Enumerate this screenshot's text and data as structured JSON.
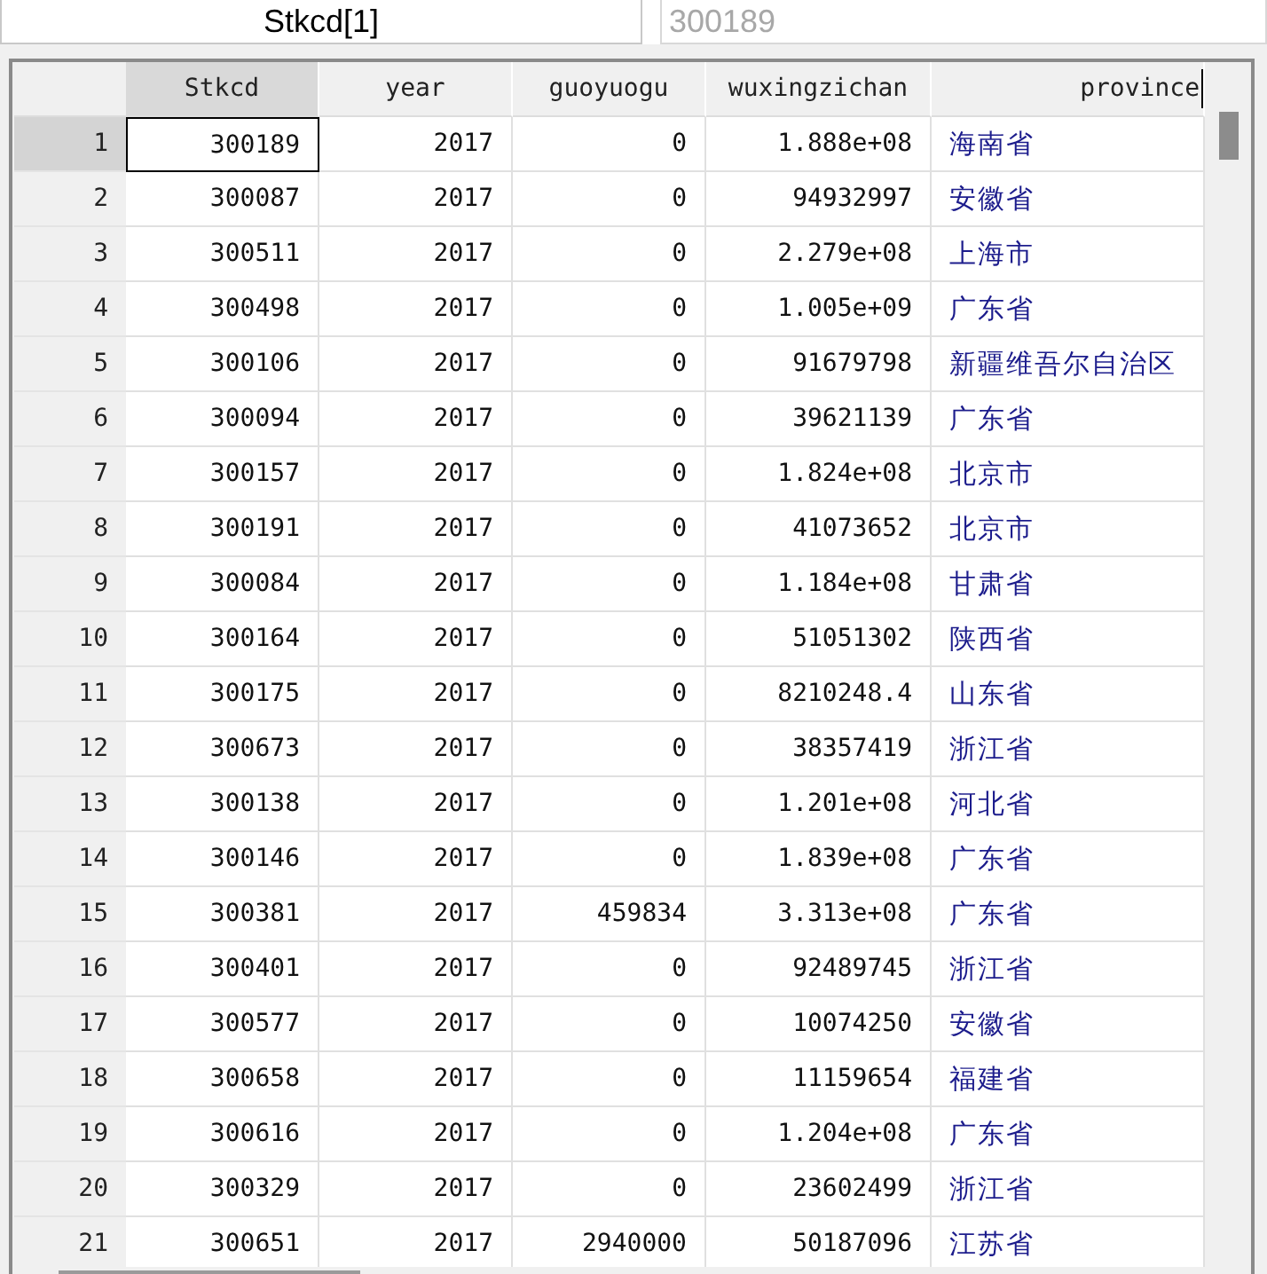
{
  "variable_box": {
    "label": "Stkcd[1]"
  },
  "value_field": {
    "value": "300189",
    "disabled": true
  },
  "table": {
    "columns": [
      {
        "name": "Stkcd",
        "kind": "numeric",
        "selected": true
      },
      {
        "name": "year",
        "kind": "numeric",
        "selected": false
      },
      {
        "name": "guoyuogu",
        "kind": "numeric",
        "selected": false
      },
      {
        "name": "wuxingzichan",
        "kind": "numeric",
        "selected": false
      },
      {
        "name": "province",
        "kind": "string",
        "selected": false
      }
    ],
    "rows": [
      {
        "number": "1",
        "selected": true,
        "cells": [
          "300189",
          "2017",
          "0",
          "1.888e+08",
          "海南省"
        ]
      },
      {
        "number": "2",
        "selected": false,
        "cells": [
          "300087",
          "2017",
          "0",
          "94932997",
          "安徽省"
        ]
      },
      {
        "number": "3",
        "selected": false,
        "cells": [
          "300511",
          "2017",
          "0",
          "2.279e+08",
          "上海市"
        ]
      },
      {
        "number": "4",
        "selected": false,
        "cells": [
          "300498",
          "2017",
          "0",
          "1.005e+09",
          "广东省"
        ]
      },
      {
        "number": "5",
        "selected": false,
        "cells": [
          "300106",
          "2017",
          "0",
          "91679798",
          "新疆维吾尔自治区"
        ]
      },
      {
        "number": "6",
        "selected": false,
        "cells": [
          "300094",
          "2017",
          "0",
          "39621139",
          "广东省"
        ]
      },
      {
        "number": "7",
        "selected": false,
        "cells": [
          "300157",
          "2017",
          "0",
          "1.824e+08",
          "北京市"
        ]
      },
      {
        "number": "8",
        "selected": false,
        "cells": [
          "300191",
          "2017",
          "0",
          "41073652",
          "北京市"
        ]
      },
      {
        "number": "9",
        "selected": false,
        "cells": [
          "300084",
          "2017",
          "0",
          "1.184e+08",
          "甘肃省"
        ]
      },
      {
        "number": "10",
        "selected": false,
        "cells": [
          "300164",
          "2017",
          "0",
          "51051302",
          "陕西省"
        ]
      },
      {
        "number": "11",
        "selected": false,
        "cells": [
          "300175",
          "2017",
          "0",
          "8210248.4",
          "山东省"
        ]
      },
      {
        "number": "12",
        "selected": false,
        "cells": [
          "300673",
          "2017",
          "0",
          "38357419",
          "浙江省"
        ]
      },
      {
        "number": "13",
        "selected": false,
        "cells": [
          "300138",
          "2017",
          "0",
          "1.201e+08",
          "河北省"
        ]
      },
      {
        "number": "14",
        "selected": false,
        "cells": [
          "300146",
          "2017",
          "0",
          "1.839e+08",
          "广东省"
        ]
      },
      {
        "number": "15",
        "selected": false,
        "cells": [
          "300381",
          "2017",
          "459834",
          "3.313e+08",
          "广东省"
        ]
      },
      {
        "number": "16",
        "selected": false,
        "cells": [
          "300401",
          "2017",
          "0",
          "92489745",
          "浙江省"
        ]
      },
      {
        "number": "17",
        "selected": false,
        "cells": [
          "300577",
          "2017",
          "0",
          "10074250",
          "安徽省"
        ]
      },
      {
        "number": "18",
        "selected": false,
        "cells": [
          "300658",
          "2017",
          "0",
          "11159654",
          "福建省"
        ]
      },
      {
        "number": "19",
        "selected": false,
        "cells": [
          "300616",
          "2017",
          "0",
          "1.204e+08",
          "广东省"
        ]
      },
      {
        "number": "20",
        "selected": false,
        "cells": [
          "300329",
          "2017",
          "0",
          "23602499",
          "浙江省"
        ]
      },
      {
        "number": "21",
        "selected": false,
        "cells": [
          "300651",
          "2017",
          "2940000",
          "50187096",
          "江苏省"
        ]
      }
    ]
  }
}
